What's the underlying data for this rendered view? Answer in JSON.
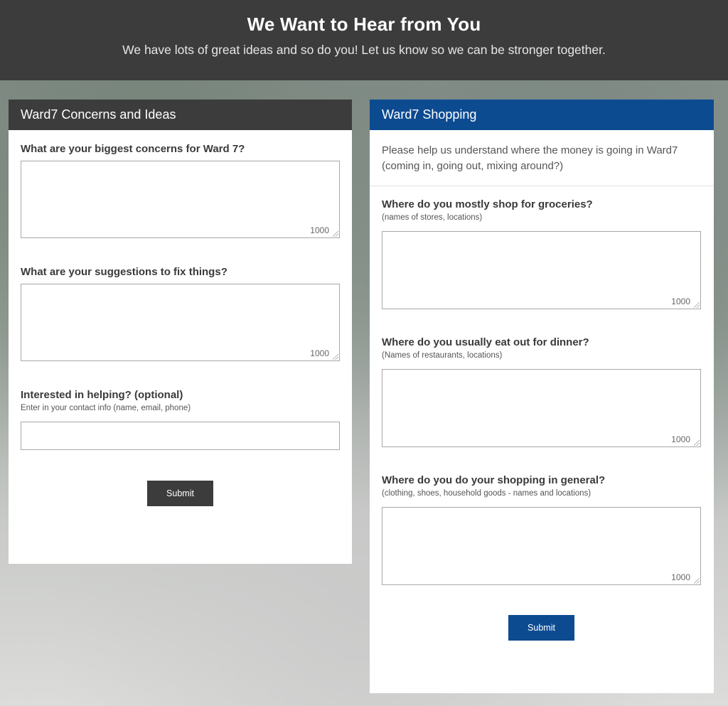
{
  "header": {
    "title": "We Want to Hear from You",
    "subtitle": "We have lots of great ideas and so do you! Let us know so we can be stronger together."
  },
  "left_card": {
    "title": "Ward7 Concerns and Ideas",
    "q1": {
      "label": "What are your biggest concerns for Ward 7?",
      "counter": "1000"
    },
    "q2": {
      "label": "What are your suggestions to fix things?",
      "counter": "1000"
    },
    "q3": {
      "label": "Interested in helping? (optional)",
      "hint": "Enter in your contact info (name, email, phone)",
      "value": ""
    },
    "submit_label": "Submit"
  },
  "right_card": {
    "title": "Ward7 Shopping",
    "intro": "Please help us understand where the money is going in Ward7 (coming in, going out, mixing around?)",
    "q1": {
      "label": "Where do you mostly shop for groceries?",
      "hint": "(names of stores, locations)",
      "counter": "1000"
    },
    "q2": {
      "label": "Where do you usually eat out for dinner?",
      "hint": "(Names of restaurants, locations)",
      "counter": "1000"
    },
    "q3": {
      "label": "Where do you do your shopping in general?",
      "hint": "(clothing, shoes, household goods - names and locations)",
      "counter": "1000"
    },
    "submit_label": "Submit"
  },
  "colors": {
    "header_bg": "#3c3c3c",
    "left_card_header": "#3c3c3c",
    "right_card_header": "#0d4b91"
  }
}
